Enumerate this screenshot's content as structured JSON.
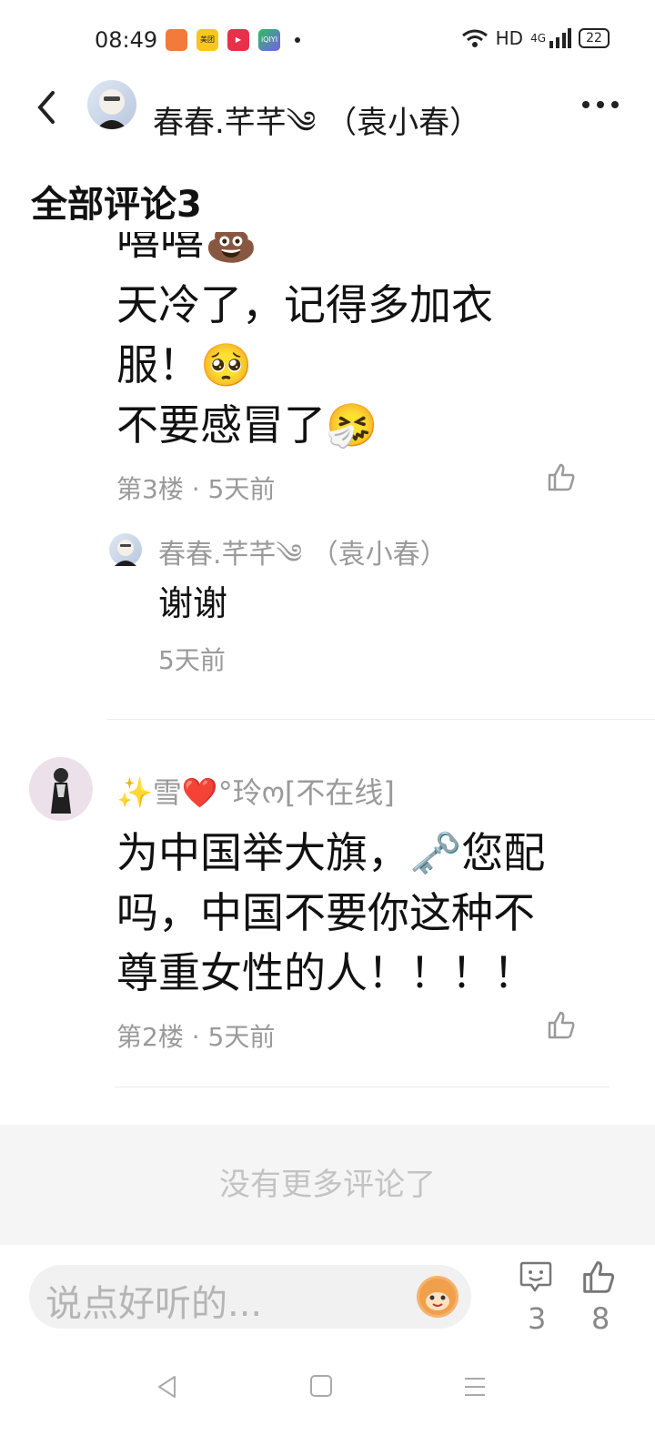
{
  "status_bar": {
    "time": "08:49",
    "app_icons": [
      "books-app-icon",
      "meituan-app-icon",
      "video-app-icon",
      "iqiyi-app-icon"
    ],
    "meituan_label": "美团",
    "iqiyi_label": "iQIYI",
    "network": "HD",
    "signal": "4G",
    "battery": "22"
  },
  "header": {
    "title": "春春.芊芊༄ （袁小春）"
  },
  "section": {
    "title": "全部评论3"
  },
  "comments": [
    {
      "cut_text": "嘻嘻💩",
      "lines": [
        "天冷了，记得多加衣",
        "服！🥺",
        "不要感冒了🤧"
      ],
      "meta": "第3楼 · 5天前",
      "reply": {
        "name": "春春.芊芊༄ （袁小春）",
        "text": "谢谢",
        "time": "5天前"
      }
    },
    {
      "name": "✨雪❤️°玲ო[不在线]",
      "lines": [
        "为中国举大旗，🗝️您配",
        "吗，中国不要你这种不",
        "尊重女性的人！！！！"
      ],
      "meta": "第2楼 · 5天前"
    }
  ],
  "footer": {
    "no_more": "没有更多评论了"
  },
  "bottom_bar": {
    "placeholder": "说点好听的...",
    "comment_count": "3",
    "like_count": "8"
  },
  "colors": {
    "text_primary": "#111111",
    "text_secondary": "#9a9a9a",
    "divider": "#ececec",
    "no_more_bg": "#f5f5f5"
  }
}
